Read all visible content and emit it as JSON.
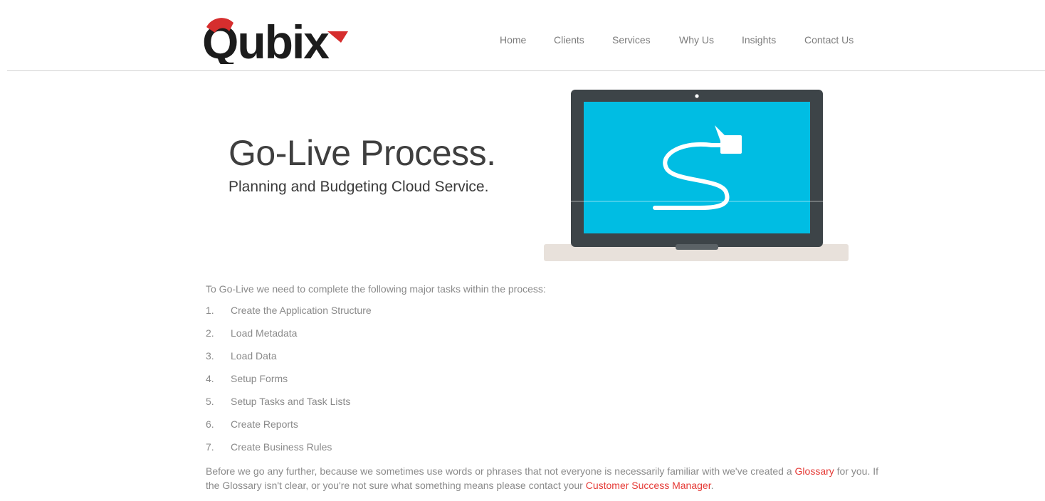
{
  "header": {
    "logo_text": "Qubix",
    "nav": [
      {
        "label": "Home"
      },
      {
        "label": "Clients"
      },
      {
        "label": "Services"
      },
      {
        "label": "Why Us"
      },
      {
        "label": "Insights"
      },
      {
        "label": "Contact Us"
      }
    ]
  },
  "hero": {
    "title": "Go-Live Process.",
    "subtitle": "Planning and Budgeting Cloud Service.",
    "image_icon": "laptop-with-cable-icon"
  },
  "content": {
    "intro": "To Go-Live we need to complete the following major tasks within the process:",
    "tasks": [
      {
        "num": "1.",
        "label": "Create the Application Structure"
      },
      {
        "num": "2.",
        "label": "Load Metadata"
      },
      {
        "num": "3.",
        "label": "Load Data"
      },
      {
        "num": "4.",
        "label": "Setup Forms"
      },
      {
        "num": "5.",
        "label": "Setup Tasks and Task Lists"
      },
      {
        "num": "6.",
        "label": "Create Reports"
      },
      {
        "num": "7.",
        "label": "Create Business Rules"
      }
    ],
    "outro_part1": "Before we go any further, because we sometimes use words or phrases that not everyone is necessarily familiar with we've created a",
    "glossary_link": "Glossary",
    "outro_part2": "for you.  If the Glossary isn't clear, or you're not sure what something means please contact your",
    "csm_link": "Customer Success Manager",
    "outro_end": "."
  },
  "colors": {
    "brand_red": "#d62e2e",
    "brand_dark": "#1c1c1c",
    "link_red": "#e53935",
    "screen_cyan": "#00bde3",
    "laptop_frame": "#3d4448",
    "laptop_base": "#e8e1db"
  }
}
